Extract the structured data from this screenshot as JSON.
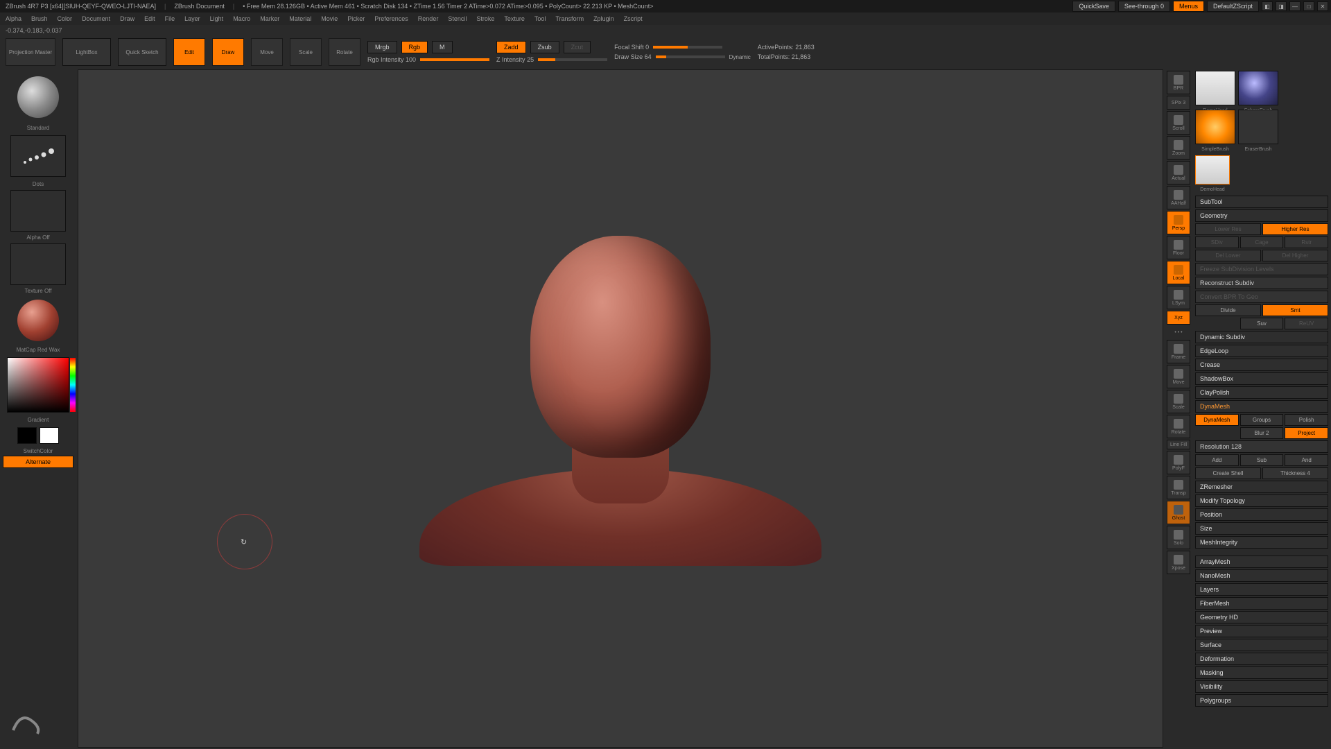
{
  "topbar": {
    "title": "ZBrush 4R7 P3 [x64][SIUH-QEYF-QWEO-LJTI-NAEA]",
    "doc": "ZBrush Document",
    "stats": "• Free Mem 28.126GB • Active Mem 461 • Scratch Disk 134 • ZTime 1.56 Timer 2 ATime>0.072 ATime>0.095 • PolyCount> 22.213 KP • MeshCount>",
    "quicksave": "QuickSave",
    "seethrough": "See-through 0",
    "menus": "Menus",
    "default": "DefaultZScript"
  },
  "menu": [
    "Alpha",
    "Brush",
    "Color",
    "Document",
    "Draw",
    "Edit",
    "File",
    "Layer",
    "Light",
    "Macro",
    "Marker",
    "Material",
    "Movie",
    "Picker",
    "Preferences",
    "Render",
    "Stencil",
    "Stroke",
    "Texture",
    "Tool",
    "Transform",
    "Zplugin",
    "Zscript"
  ],
  "status": "-0.374,-0.183,-0.037",
  "toolbar": {
    "projection": "Projection Master",
    "lightbox": "LightBox",
    "quicksketch": "Quick Sketch",
    "edit": "Edit",
    "draw": "Draw",
    "move": "Move",
    "scale": "Scale",
    "rotate": "Rotate",
    "mrgb": "Mrgb",
    "rgb": "Rgb",
    "m": "M",
    "rgbint": "Rgb Intensity 100",
    "zadd": "Zadd",
    "zsub": "Zsub",
    "zcut": "Zcut",
    "zint": "Z Intensity 25",
    "focal": "Focal Shift 0",
    "drawsize": "Draw Size 64",
    "dynamic": "Dynamic",
    "active": "ActivePoints: 21,863",
    "total": "TotalPoints: 21,863"
  },
  "left": {
    "brush": "Standard",
    "stroke": "Dots",
    "alpha": "Alpha Off",
    "texture": "Texture Off",
    "material": "MatCap Red Wax",
    "gradient": "Gradient",
    "switch": "SwitchColor",
    "alternate": "Alternate"
  },
  "sidetools": {
    "spix": "SPix 3",
    "bpr": "BPR",
    "scroll": "Scroll",
    "zoom": "Zoom",
    "actual": "Actual",
    "aahalf": "AAHalf",
    "persp": "Persp",
    "floor": "Floor",
    "local": "Local",
    "lsym": "LSym",
    "xyz": "Xyz",
    "frame": "Frame",
    "move": "Move",
    "scale": "Scale",
    "rotate": "Rotate",
    "polyf": "PolyF",
    "transp": "Transp",
    "ghost": "Ghost",
    "solo": "Solo",
    "xpose": "Xpose"
  },
  "right": {
    "tools": {
      "demohead": "DemoHead",
      "sphere": "SphereBrush",
      "simple": "SimpleBrush",
      "eraser": "EraserBrush"
    },
    "subtool": "SubTool",
    "geometry": "Geometry",
    "lowerres": "Lower Res",
    "higherres": "Higher Res",
    "sdiv": "SDiv",
    "cage": "Cage",
    "rstr": "Rstr",
    "dellower": "Del Lower",
    "delhigher": "Del Higher",
    "freeze": "Freeze SubDivision Levels",
    "reconstruct": "Reconstruct Subdiv",
    "convert": "Convert BPR To Geo",
    "divide": "Divide",
    "smt": "Smt",
    "suv": "Suv",
    "resv": "ReUV",
    "dynsubdiv": "Dynamic Subdiv",
    "edgeloop": "EdgeLoop",
    "crease": "Crease",
    "shadowbox": "ShadowBox",
    "claypolish": "ClayPolish",
    "dynamesh_h": "DynaMesh",
    "dynamesh": "DynaMesh",
    "groups": "Groups",
    "polish": "Polish",
    "blur": "Blur 2",
    "project": "Project",
    "resolution": "Resolution 128",
    "add": "Add",
    "sub": "Sub",
    "and": "And",
    "createshell": "Create Shell",
    "thickness": "Thickness 4",
    "zremesher": "ZRemesher",
    "modtopo": "Modify Topology",
    "position": "Position",
    "size": "Size",
    "meshint": "MeshIntegrity",
    "arraymesh": "ArrayMesh",
    "nanomesh": "NanoMesh",
    "layers": "Layers",
    "fibermesh": "FiberMesh",
    "geohd": "Geometry HD",
    "preview": "Preview",
    "surface": "Surface",
    "deformation": "Deformation",
    "masking": "Masking",
    "visibility": "Visibility",
    "polygroups": "Polygroups"
  }
}
